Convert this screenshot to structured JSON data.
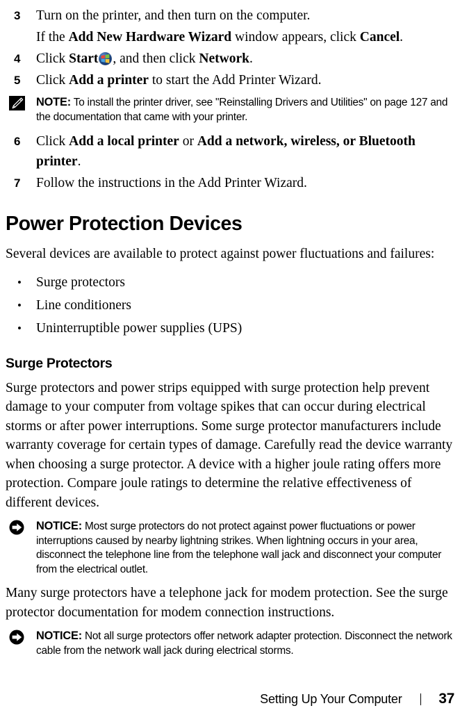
{
  "document": {
    "type": "printed-manual-page",
    "page_number": "37",
    "footer_title": "Setting Up Your Computer",
    "footer_separator": "|"
  },
  "steps": [
    {
      "number": "3",
      "lines": [
        [
          {
            "text": "Turn on the printer, and then turn on the computer.",
            "bold": false
          }
        ],
        [
          {
            "text": "If the ",
            "bold": false
          },
          {
            "text": "Add New Hardware Wizard",
            "bold": true
          },
          {
            "text": " window appears, click ",
            "bold": false
          },
          {
            "text": "Cancel",
            "bold": true
          },
          {
            "text": ".",
            "bold": false
          }
        ]
      ]
    },
    {
      "number": "4",
      "lines": [
        [
          {
            "text": "Click ",
            "bold": false
          },
          {
            "text": "Start",
            "bold": true
          },
          {
            "icon": "windows-start-orb"
          },
          {
            "text": ", and then click ",
            "bold": false
          },
          {
            "text": "Network",
            "bold": true
          },
          {
            "text": ".",
            "bold": false
          }
        ]
      ]
    },
    {
      "number": "5",
      "lines": [
        [
          {
            "text": "Click ",
            "bold": false
          },
          {
            "text": "Add a printer",
            "bold": true
          },
          {
            "text": " to start the Add Printer Wizard.",
            "bold": false
          }
        ]
      ]
    },
    {
      "number": "6",
      "lines": [
        [
          {
            "text": "Click ",
            "bold": false
          },
          {
            "text": "Add a local printer",
            "bold": true
          },
          {
            "text": " or ",
            "bold": false
          },
          {
            "text": "Add a network, wireless, or Bluetooth printer",
            "bold": true
          },
          {
            "text": ".",
            "bold": false
          }
        ]
      ]
    },
    {
      "number": "7",
      "lines": [
        [
          {
            "text": "Follow the instructions in the Add Printer Wizard.",
            "bold": false
          }
        ]
      ]
    }
  ],
  "note_callout": {
    "icon": "note-pencil-icon",
    "label": "NOTE:",
    "text": " To install the printer driver, see \"Reinstalling Drivers and Utilities\" on page 127 and the documentation that came with your printer."
  },
  "section": {
    "title": "Power Protection Devices",
    "intro": "Several devices are available to protect against power fluctuations and failures:",
    "bullets": [
      {
        "bullet": "•",
        "label": "Surge protectors"
      },
      {
        "bullet": "•",
        "label": "Line conditioners"
      },
      {
        "bullet": "•",
        "label": "Uninterruptible power supplies (UPS)"
      }
    ]
  },
  "subsection": {
    "title": "Surge Protectors",
    "paragraph_1": "Surge protectors and power strips equipped with surge protection help prevent damage to your computer from voltage spikes that can occur during electrical storms or after power interruptions. Some surge protector manufacturers include warranty coverage for certain types of damage. Carefully read the device warranty when choosing a surge protector. A device with a higher joule rating offers more protection. Compare joule ratings to determine the relative effectiveness of different devices.",
    "paragraph_2": "Many surge protectors have a telephone jack for modem protection. See the surge protector documentation for modem connection instructions."
  },
  "notice_callout_1": {
    "icon": "notice-arrow-icon",
    "label": "NOTICE:",
    "text": " Most surge protectors do not protect against power fluctuations or power interruptions caused by nearby lightning strikes. When lightning occurs in your area, disconnect the telephone line from the telephone wall jack and disconnect your computer from the electrical outlet."
  },
  "notice_callout_2": {
    "icon": "notice-arrow-icon",
    "label": "NOTICE:",
    "text": " Not all surge protectors offer network adapter protection. Disconnect the network cable from the network wall jack during electrical storms."
  },
  "colors": {
    "text": "#000000",
    "background": "#ffffff",
    "orb_blue": "#1f4a86",
    "win_red": "#e8483a",
    "win_green": "#7bc043",
    "win_blue": "#4aa3e0",
    "win_yellow": "#f5c23a"
  }
}
